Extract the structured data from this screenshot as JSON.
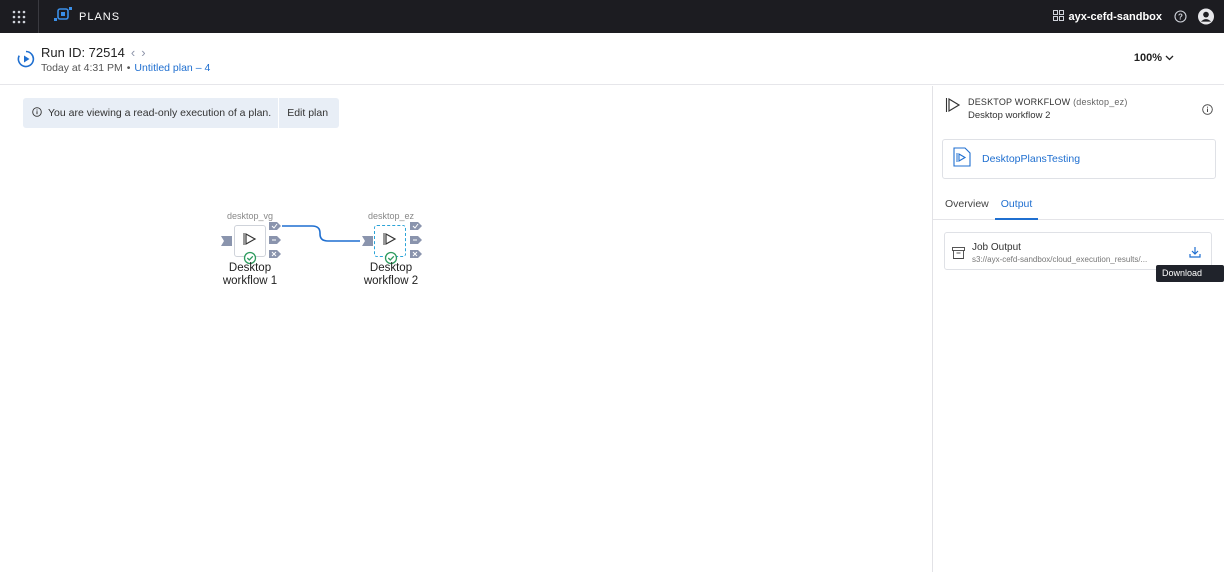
{
  "topbar": {
    "app_name": "PLANS",
    "workspace": "ayx-cefd-sandbox",
    "icons": [
      "apps-grid-icon",
      "plans-logo-icon",
      "workspace-icon",
      "help-icon",
      "user-avatar-icon"
    ]
  },
  "header": {
    "run_id_label": "Run ID: 72514",
    "time": "Today at 4:31 PM",
    "separator": "•",
    "plan_link": "Untitled plan – 4",
    "zoom": "100%"
  },
  "canvas": {
    "banner_message": "You are viewing a read-only execution of a plan.",
    "edit_button": "Edit plan",
    "nodes": [
      {
        "id_label": "desktop_vg",
        "name_line1": "Desktop",
        "name_line2": "workflow 1",
        "selected": false
      },
      {
        "id_label": "desktop_ez",
        "name_line1": "Desktop",
        "name_line2": "workflow 2",
        "selected": true
      }
    ]
  },
  "panel": {
    "type_label": "DESKTOP WORKFLOW",
    "type_id": "(desktop_ez)",
    "name": "Desktop workflow 2",
    "workflow_card": "DesktopPlansTesting",
    "tabs": [
      "Overview",
      "Output"
    ],
    "active_tab": "Output",
    "job_output": {
      "title": "Job Output",
      "path": "s3://ayx-cefd-sandbox/cloud_execution_results/..."
    },
    "tooltip": "Download File"
  },
  "colors": {
    "topbar_bg": "#1c1c21",
    "accent": "#1f6fd0",
    "node_port": "#8a94ad",
    "success": "#2e9b5e"
  }
}
